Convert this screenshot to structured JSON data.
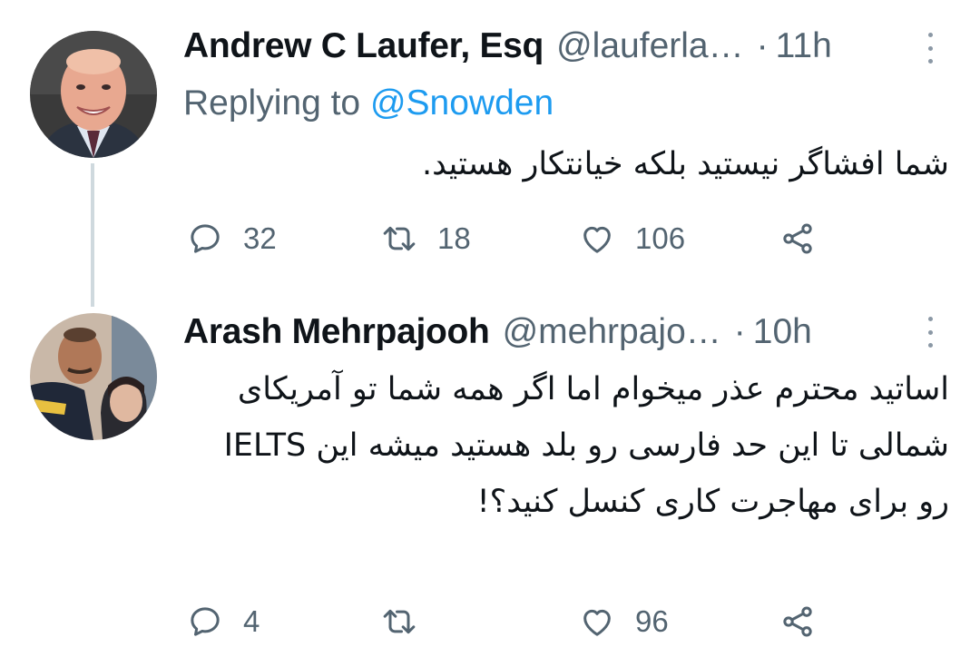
{
  "tweets": [
    {
      "name": "Andrew C Laufer, Esq",
      "handle": "@lauferla…",
      "separator": "·",
      "time": "11h",
      "replying_label": "Replying to ",
      "replying_to": "@Snowden",
      "text": "شما افشاگر نیستید بلکه خیانتکار هستید.",
      "replies": "32",
      "retweets": "18",
      "likes": "106"
    },
    {
      "name": "Arash Mehrpajooh",
      "handle": "@mehrpajo…",
      "separator": "·",
      "time": "10h",
      "text": "اساتید محترم عذر میخوام اما اگر همه شما تو آمریکای شمالی تا این حد فارسی رو بلد هستید میشه این IELTS رو برای مهاجرت کاری کنسل کنید؟!",
      "replies": "4",
      "retweets": "",
      "likes": "96"
    }
  ],
  "icons": {
    "reply": "reply-icon",
    "retweet": "retweet-icon",
    "like": "heart-icon",
    "share": "share-icon",
    "more": "more-vertical-icon"
  },
  "colors": {
    "text": "#0f1419",
    "secondary": "#536471",
    "mention": "#1d9bf0",
    "thread_line": "#cfd9de"
  }
}
